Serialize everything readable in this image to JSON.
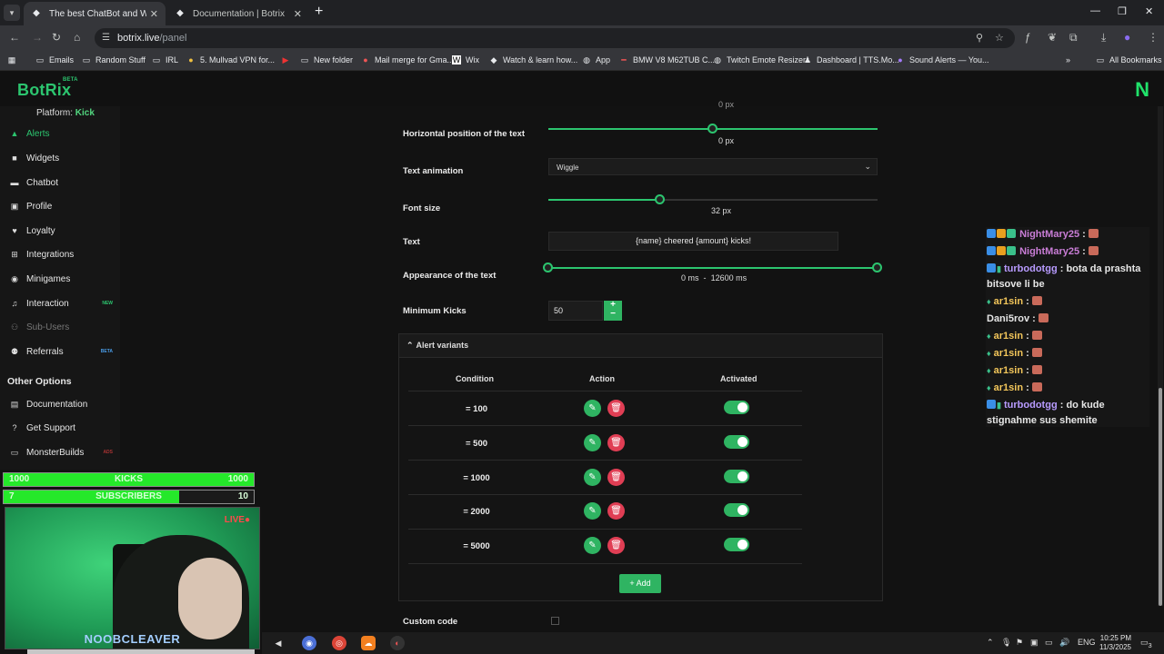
{
  "browser": {
    "tabs": [
      {
        "title": "The best ChatBot and Widgets"
      },
      {
        "title": "Documentation | Botrix"
      }
    ],
    "url_host": "botrix.live",
    "url_path": "/panel",
    "bookmarks": [
      {
        "label": "Emails",
        "icon": "folder-icon"
      },
      {
        "label": "Random Stuff",
        "icon": "folder-icon"
      },
      {
        "label": "IRL",
        "icon": "folder-icon"
      },
      {
        "label": "5. Mullvad VPN for...",
        "icon": "mullvad-icon"
      },
      {
        "label": "",
        "icon": "youtube-icon"
      },
      {
        "label": "New folder",
        "icon": "folder-icon"
      },
      {
        "label": "Mail merge for Gma...",
        "icon": "mailmerge-icon"
      },
      {
        "label": "Wix",
        "icon": "wix-icon"
      },
      {
        "label": "Watch & learn how...",
        "icon": "site-icon"
      },
      {
        "label": "App",
        "icon": "globe-icon"
      },
      {
        "label": "BMW V8 M62TUB C...",
        "icon": "site-icon"
      },
      {
        "label": "Twitch Emote Resizer",
        "icon": "globe-icon"
      },
      {
        "label": "Dashboard | TTS.Mo...",
        "icon": "site-icon"
      },
      {
        "label": "Sound Alerts — You...",
        "icon": "soundalerts-icon"
      }
    ],
    "all_bookmarks": "All Bookmarks"
  },
  "app": {
    "logo": "BotRix",
    "logo_badge": "BETA",
    "corner_logo": "N",
    "platform_label": "Platform:",
    "platform_value": "Kick"
  },
  "sidebar": {
    "items": [
      {
        "label": "Alerts",
        "icon": "bell-icon",
        "badge": ""
      },
      {
        "label": "Widgets",
        "icon": "widgets-icon",
        "badge": ""
      },
      {
        "label": "Chatbot",
        "icon": "chat-icon",
        "badge": ""
      },
      {
        "label": "Profile",
        "icon": "profile-icon",
        "badge": ""
      },
      {
        "label": "Loyalty",
        "icon": "loyalty-icon",
        "badge": ""
      },
      {
        "label": "Integrations",
        "icon": "integrations-icon",
        "badge": ""
      },
      {
        "label": "Minigames",
        "icon": "gamepad-icon",
        "badge": ""
      },
      {
        "label": "Interaction",
        "icon": "music-icon",
        "badge": "NEW"
      },
      {
        "label": "Sub-Users",
        "icon": "users-icon",
        "badge": ""
      },
      {
        "label": "Referrals",
        "icon": "referrals-icon",
        "badge": "BETA"
      }
    ],
    "other_options_title": "Other Options",
    "other": [
      {
        "label": "Documentation",
        "icon": "book-icon",
        "badge": ""
      },
      {
        "label": "Get Support",
        "icon": "help-icon",
        "badge": ""
      },
      {
        "label": "MonsterBuilds",
        "icon": "monitor-icon",
        "badge": "ADS"
      }
    ]
  },
  "overlay": {
    "kicks_goal": {
      "left": "1000",
      "label": "KICKS",
      "right": "1000",
      "progress": 1.0
    },
    "subs_goal": {
      "left": "7",
      "label": "SUBSCRIBERS",
      "right": "10",
      "progress": 0.7
    },
    "live_label": "LIVE",
    "streamer_name": "NOOBCLEAVER"
  },
  "form": {
    "top_value": "0",
    "top_unit": "px",
    "horizontal_label": "Horizontal position of the text",
    "horizontal_value": "0",
    "horizontal_unit": "px",
    "horizontal_position": 0.5,
    "text_animation_label": "Text animation",
    "text_animation_value": "Wiggle",
    "font_size_label": "Font size",
    "font_size_value": "32",
    "font_size_unit": "px",
    "font_size_position": 0.34,
    "text_label": "Text",
    "text_value": "{name} cheered {amount} kicks!",
    "appearance_label": "Appearance of the text",
    "appearance_start": "0",
    "appearance_sep": "-",
    "appearance_end": "12600",
    "appearance_unit": "ms",
    "min_kicks_label": "Minimum Kicks",
    "min_kicks_value": "50",
    "variants_title": "Alert variants",
    "col_condition": "Condition",
    "col_action": "Action",
    "col_activated": "Activated",
    "variants": [
      {
        "condition": "= 100",
        "activated": true
      },
      {
        "condition": "= 500",
        "activated": true
      },
      {
        "condition": "= 1000",
        "activated": true
      },
      {
        "condition": "= 2000",
        "activated": true
      },
      {
        "condition": "= 5000",
        "activated": true
      }
    ],
    "add_label": "Add",
    "custom_code_label": "Custom code"
  },
  "chat": {
    "messages": [
      {
        "user": "NightMary25",
        "text": "",
        "color": "#c97dd6"
      },
      {
        "user": "NightMary25",
        "text": "",
        "color": "#c97dd6"
      },
      {
        "user": "turbodotgg",
        "text": "bota da prashta bitsove li be",
        "color": "#b89bff"
      },
      {
        "user": "ar1sin",
        "text": "",
        "color": "#f3c65a"
      },
      {
        "user": "Dani5rov",
        "text": "",
        "color": "#e6e6e6"
      },
      {
        "user": "ar1sin",
        "text": "",
        "color": "#f3c65a"
      },
      {
        "user": "ar1sin",
        "text": "",
        "color": "#f3c65a"
      },
      {
        "user": "ar1sin",
        "text": "",
        "color": "#f3c65a"
      },
      {
        "user": "ar1sin",
        "text": "",
        "color": "#f3c65a"
      },
      {
        "user": "turbodotgg",
        "text": "do kude stignahme sus shemite",
        "color": "#b89bff"
      }
    ]
  },
  "taskbar": {
    "language": "ENG",
    "time": "10:25 PM",
    "date": "11/3/2025",
    "notification_count": "3"
  },
  "colors": {
    "accent": "#2cc56f",
    "danger": "#e03e54",
    "background": "#121212"
  }
}
